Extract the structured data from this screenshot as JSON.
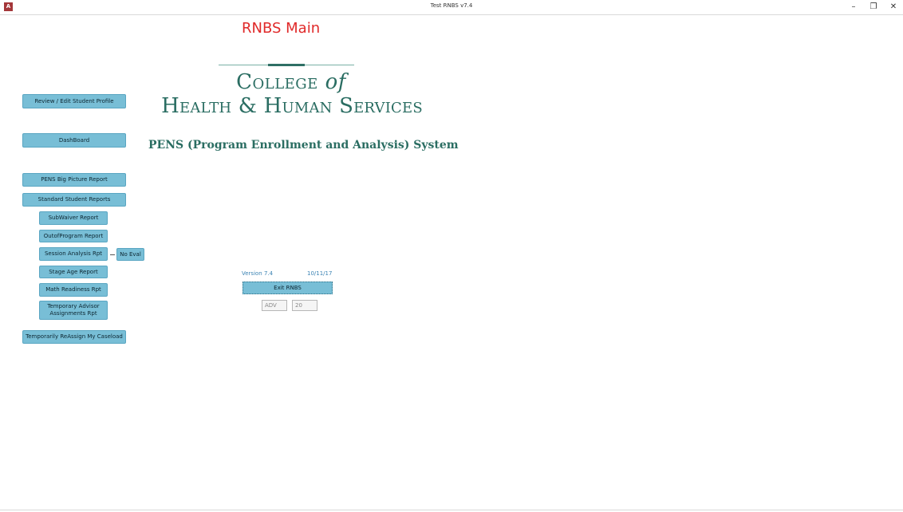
{
  "window": {
    "title": "Test RNBS v7.4",
    "app_icon": "A",
    "controls": {
      "minimize": "–",
      "restore": "❐",
      "close": "✕"
    }
  },
  "form": {
    "title": "RNBS Main"
  },
  "logo": {
    "college": "College",
    "of": "of",
    "hhs": "Health & Human Services",
    "colors": {
      "primary": "#2a6d62",
      "line": "#7ab0a5"
    }
  },
  "system_title": "PENS (Program Enrollment and Analysis) System",
  "nav": {
    "review_edit": "Review / Edit Student Profile",
    "dashboard": "DashBoard",
    "big_picture": "PENS Big Picture Report",
    "standard_reports": "Standard Student Reports",
    "subwaiver": "SubWaiver Report",
    "outofprogram": "OutofProgram Report",
    "session_analysis": "Session Analysis Rpt",
    "no_eval": "No Eval",
    "stage_age": "Stage Age Report",
    "math_readiness": "Math Readiness Rpt",
    "temp_advisor": "Temporary Advisor Assignments Rpt",
    "reassign": "Temporarily ReAssign My Caseload"
  },
  "info": {
    "version": "Version 7.4",
    "date": "10/11/17",
    "exit": "Exit RNBS",
    "adv": "ADV",
    "num": "20"
  },
  "colors": {
    "button": "#78bed6",
    "title_red": "#e02a2a",
    "version_blue": "#3c84b4"
  }
}
